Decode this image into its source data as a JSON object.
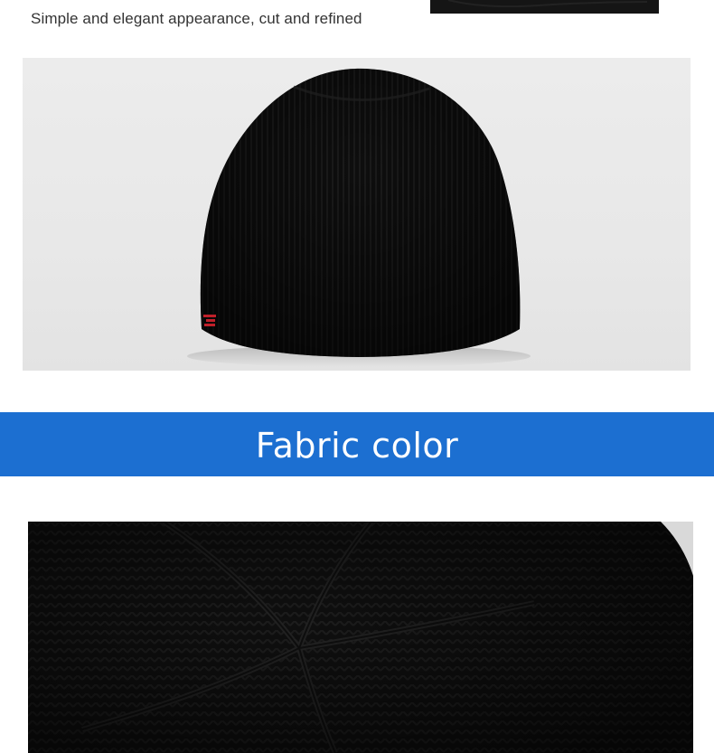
{
  "caption": "Simple and elegant appearance, cut and refined",
  "banner": {
    "title": "Fabric color",
    "color": "#1c6fd1"
  },
  "product_photo": {
    "subject": "black-knit-beanie",
    "background": "#e9e9e9",
    "accent": "#c0202a"
  },
  "fabric_photo": {
    "subject": "knit-fabric-crown-closeup",
    "color": "#101010"
  }
}
